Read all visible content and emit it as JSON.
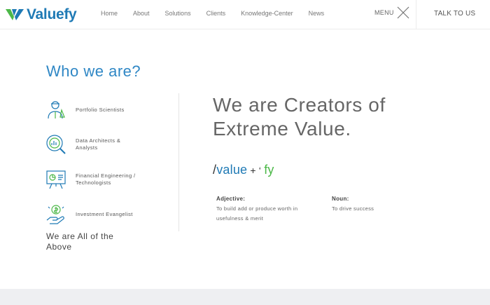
{
  "header": {
    "logo_text": "Valuefy",
    "nav": [
      "Home",
      "About",
      "Solutions",
      "Clients",
      "Knowledge-Center",
      "News"
    ],
    "menu_label": "MENU",
    "cta_label": "TALK TO US"
  },
  "left": {
    "title": "Who we are?",
    "roles": [
      {
        "label": "Portfolio Scientists",
        "icon": "scientist-icon"
      },
      {
        "label": "Data Architects & Analysts",
        "icon": "data-analysis-icon"
      },
      {
        "label": "Financial Engineering / Technologists",
        "icon": "presentation-board-icon"
      },
      {
        "label": "Investment Evangelist",
        "icon": "investment-hand-icon"
      }
    ],
    "summary": "We are All of the Above"
  },
  "right": {
    "headline": "We are Creators of Extreme Value.",
    "word": {
      "slash": "/",
      "value": "value",
      "plus": " + ‘ ",
      "fy": "fy"
    },
    "definitions": [
      {
        "pos": "Adjective:",
        "text": "To build add or produce worth in usefulness & merit"
      },
      {
        "pos": "Noun:",
        "text": "To drive success"
      }
    ]
  },
  "colors": {
    "brand_blue": "#1f7ab5",
    "brand_green": "#4cb848",
    "title_blue": "#2f87c5"
  }
}
